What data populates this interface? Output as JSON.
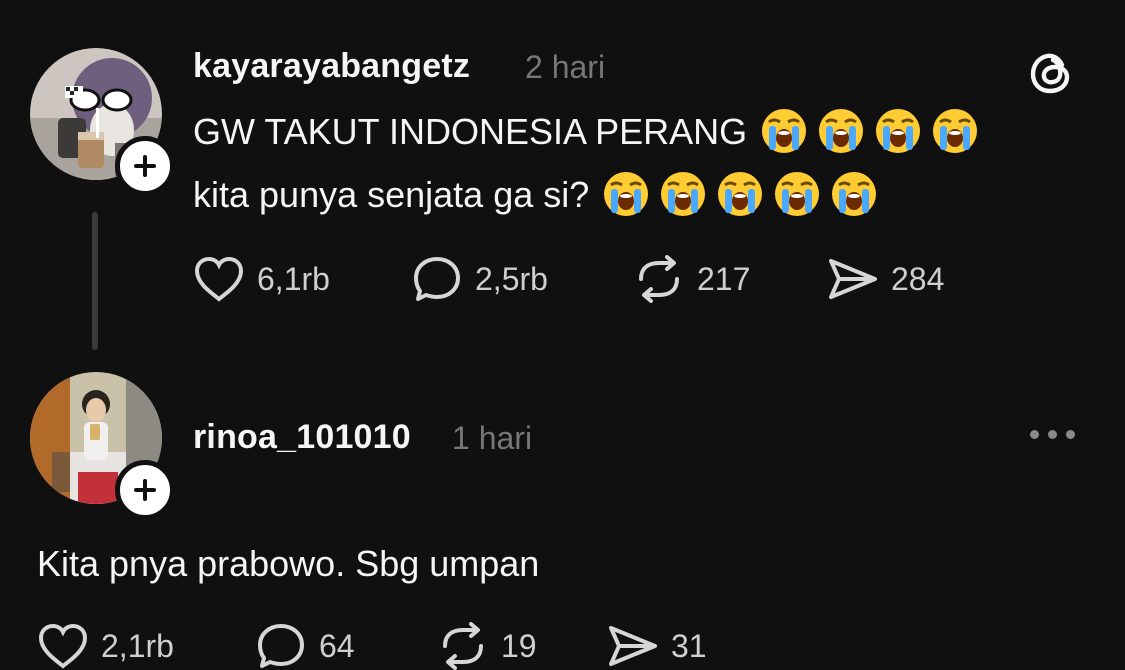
{
  "posts": [
    {
      "username": "kayarayabangetz",
      "time": "2 hari",
      "lines": [
        "GW TAKUT INDONESIA PERANG",
        "kita punya senjata ga si?"
      ],
      "emoji_counts": [
        4,
        5
      ],
      "emoji_name": "loudly-crying-face",
      "stats": {
        "likes": "6,1rb",
        "replies": "2,5rb",
        "reposts": "217",
        "shares": "284"
      }
    },
    {
      "username": "rinoa_101010",
      "time": "1 hari",
      "lines": [
        "Kita pnya prabowo. Sbg umpan"
      ],
      "stats": {
        "likes": "2,1rb",
        "replies": "64",
        "reposts": "19",
        "shares": "31"
      }
    }
  ],
  "icons": {
    "like": "heart-icon",
    "reply": "comment-bubble-icon",
    "repost": "repost-icon",
    "share": "send-icon",
    "app": "threads-logo-icon",
    "more": "more-dots-icon",
    "follow": "plus-icon"
  },
  "colors": {
    "background": "#101010",
    "text": "#f3f5f7",
    "muted": "#777777",
    "thread_line": "#3a3a3a"
  }
}
